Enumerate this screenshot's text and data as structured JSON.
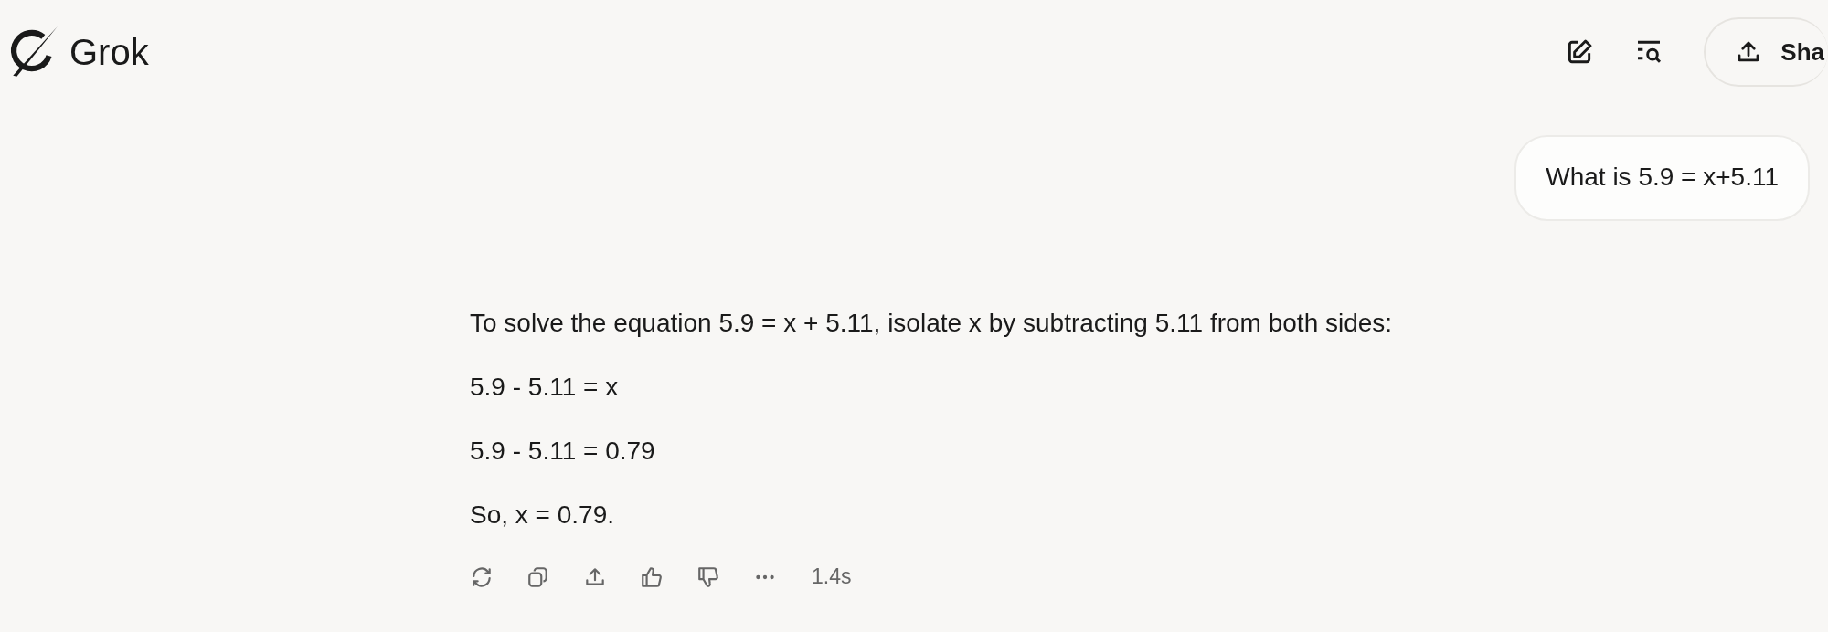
{
  "header": {
    "logo_text": "Grok",
    "share_button": "Sha"
  },
  "user_message": "What is 5.9 = x+5.11",
  "response": {
    "paragraphs": [
      "To solve the equation 5.9 = x + 5.11, isolate x by subtracting 5.11 from both sides:",
      "5.9 - 5.11 = x",
      "5.9 - 5.11 = 0.79",
      "So, x = 0.79."
    ],
    "actions": [
      {
        "kind": "regenerate"
      },
      {
        "kind": "copy"
      },
      {
        "kind": "share"
      },
      {
        "kind": "like"
      },
      {
        "kind": "dislike"
      },
      {
        "kind": "more"
      }
    ],
    "time": "1.4s"
  }
}
